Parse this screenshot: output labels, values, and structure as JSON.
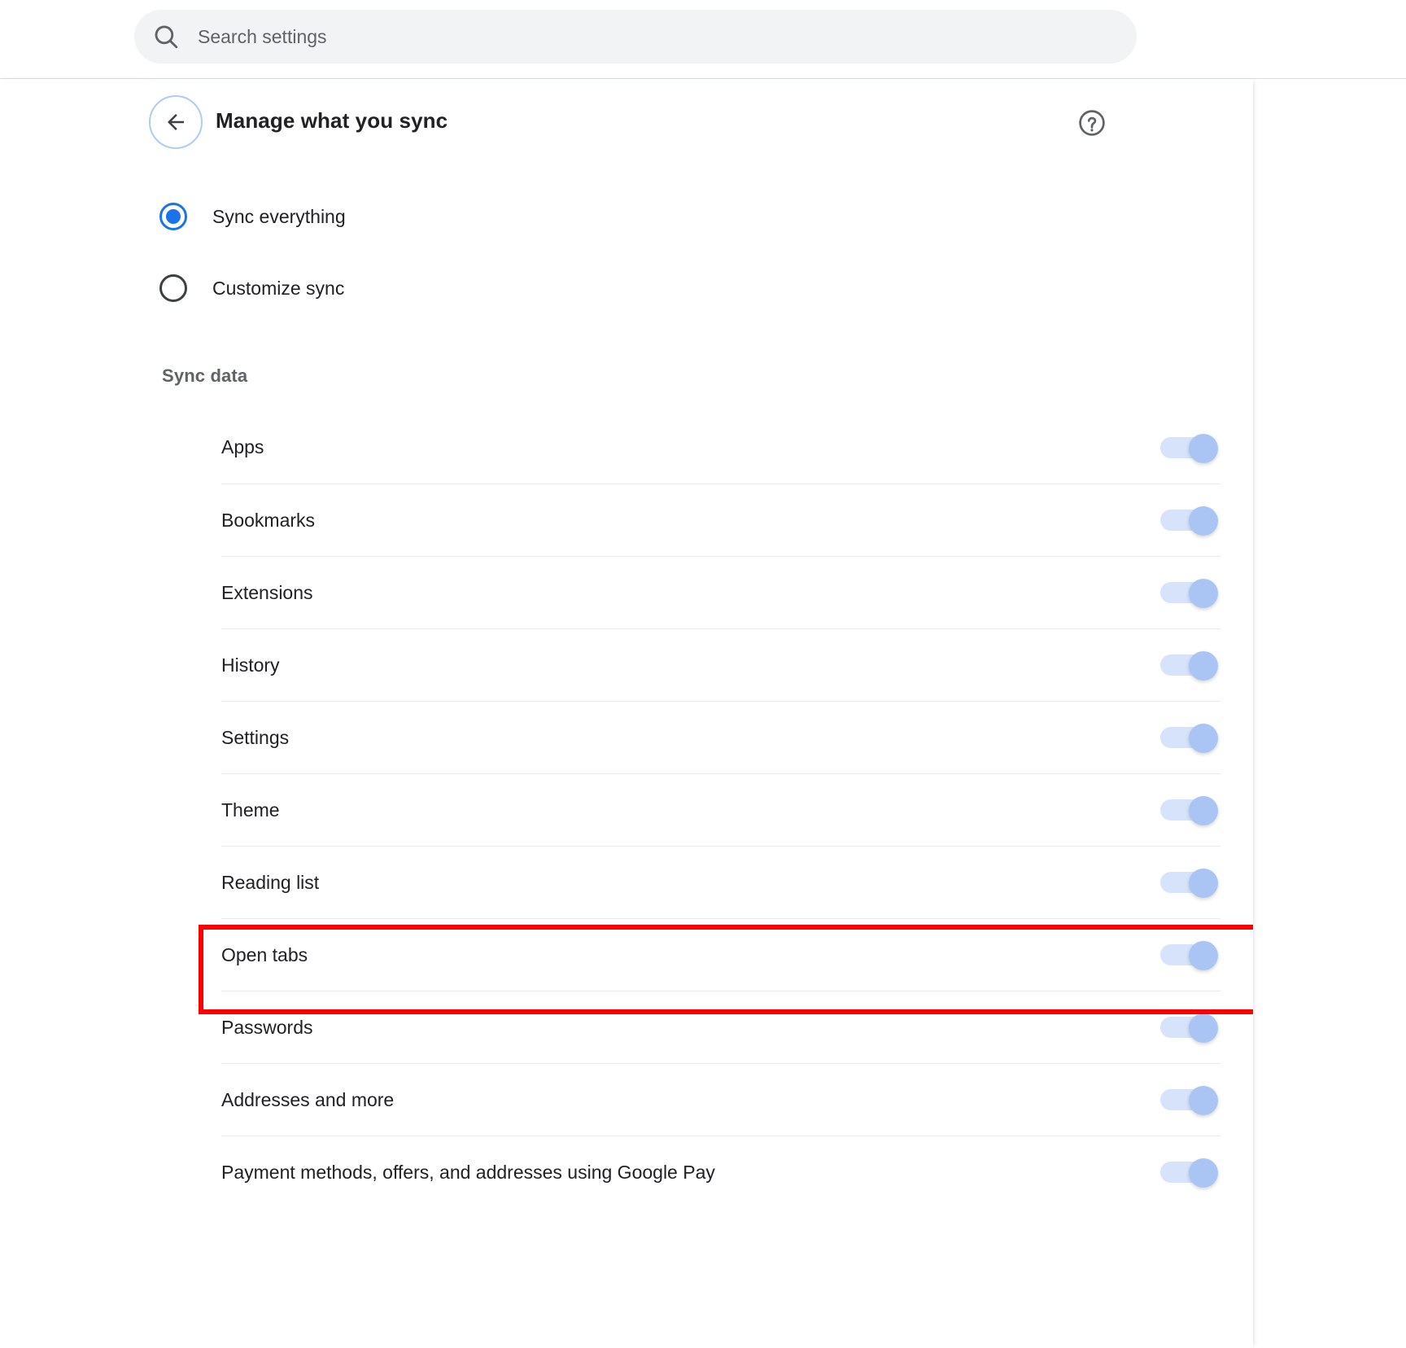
{
  "search": {
    "placeholder": "Search settings",
    "value": "",
    "icon": "search-icon"
  },
  "header": {
    "title": "Manage what you sync",
    "back_icon": "arrow-left-icon",
    "help_icon": "help-circle-icon"
  },
  "sync_mode": {
    "options": [
      {
        "label": "Sync everything",
        "selected": true
      },
      {
        "label": "Customize sync",
        "selected": false
      }
    ]
  },
  "sync_data": {
    "heading": "Sync data",
    "rows": [
      {
        "label": "Apps",
        "enabled": true
      },
      {
        "label": "Bookmarks",
        "enabled": true
      },
      {
        "label": "Extensions",
        "enabled": true
      },
      {
        "label": "History",
        "enabled": true
      },
      {
        "label": "Settings",
        "enabled": true
      },
      {
        "label": "Theme",
        "enabled": true
      },
      {
        "label": "Reading list",
        "enabled": true
      },
      {
        "label": "Open tabs",
        "enabled": true,
        "highlighted": true
      },
      {
        "label": "Passwords",
        "enabled": true
      },
      {
        "label": "Addresses and more",
        "enabled": true
      },
      {
        "label": "Payment methods, offers, and addresses using Google Pay",
        "enabled": true
      }
    ]
  },
  "annotation": {
    "target_label": "Open tabs",
    "color": "#ff0000"
  },
  "colors": {
    "accent": "#1a73e8",
    "toggle_track": "#d7e3fb",
    "toggle_knob": "#aac4f3",
    "focus_ring": "#aecbfa",
    "divider": "#e8eaed",
    "text_primary": "#202124",
    "text_secondary": "#5f6368",
    "search_bg": "#f1f3f4"
  }
}
